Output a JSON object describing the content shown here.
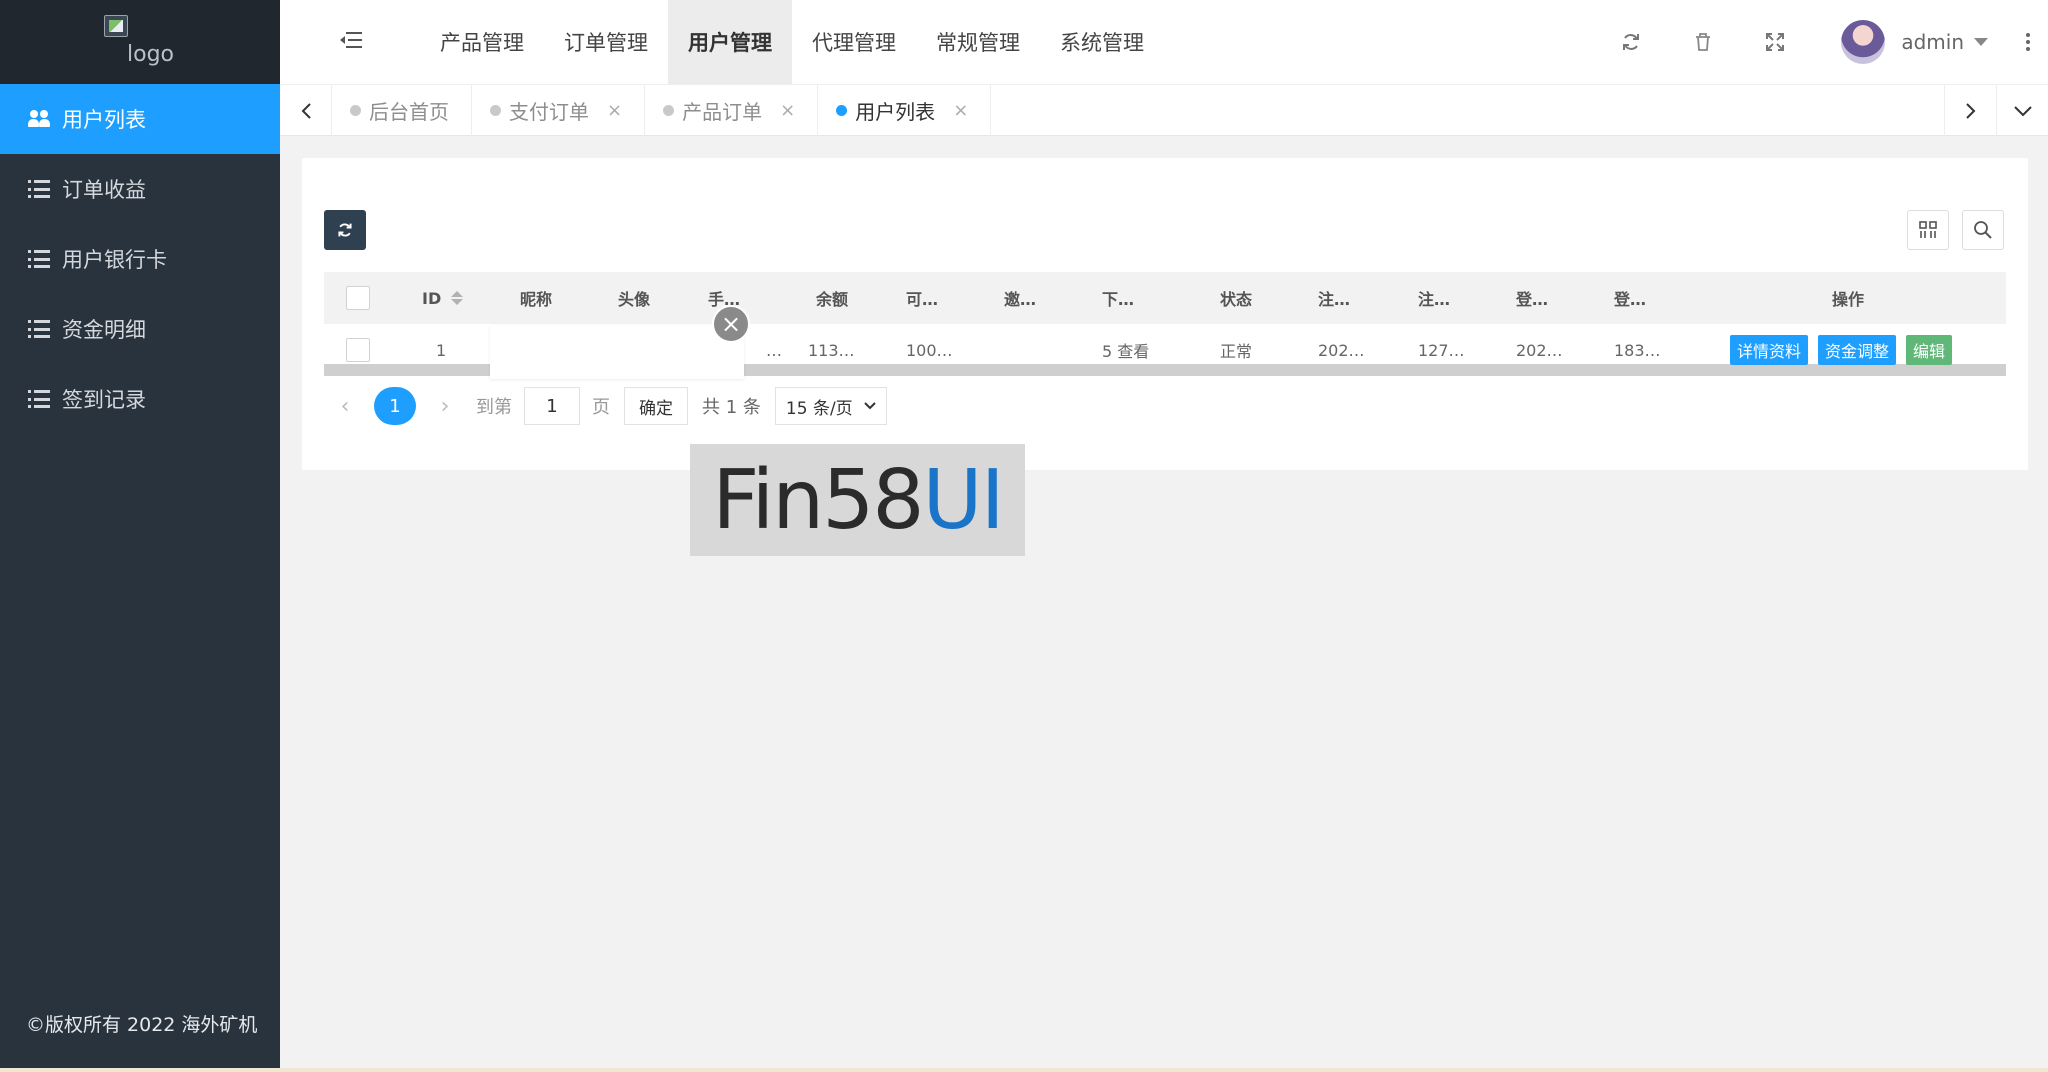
{
  "logo": {
    "alt": "logo"
  },
  "sidebar": {
    "items": [
      {
        "label": "用户列表",
        "icon": "users-icon",
        "active": true
      },
      {
        "label": "订单收益",
        "icon": "list-icon"
      },
      {
        "label": "用户银行卡",
        "icon": "list-icon"
      },
      {
        "label": "资金明细",
        "icon": "list-icon"
      },
      {
        "label": "签到记录",
        "icon": "list-icon"
      }
    ],
    "footer": "©版权所有 2022 海外矿机"
  },
  "header": {
    "nav": [
      "产品管理",
      "订单管理",
      "用户管理",
      "代理管理",
      "常规管理",
      "系统管理"
    ],
    "active_nav": "用户管理",
    "username": "admin"
  },
  "tabs": [
    {
      "label": "后台首页",
      "closable": false
    },
    {
      "label": "支付订单",
      "closable": true
    },
    {
      "label": "产品订单",
      "closable": true
    },
    {
      "label": "用户列表",
      "closable": true,
      "active": true
    }
  ],
  "table": {
    "columns": [
      "ID",
      "昵称",
      "头像",
      "手…",
      "余额",
      "可…",
      "邀…",
      "下…",
      "状态",
      "注…",
      "注…",
      "登…",
      "登…",
      "操作"
    ],
    "rows": [
      {
        "id": "1",
        "nickname": "",
        "avatar": "",
        "phone": "…",
        "balance": "113…",
        "available": "100…",
        "invite": "",
        "sub": "5 查看",
        "status": "正常",
        "reg_time": "202…",
        "reg_ip": "127…",
        "login_time": "202…",
        "login_ip": "183…"
      }
    ],
    "actions": [
      "详情资料",
      "资金调整",
      "编辑"
    ]
  },
  "pagination": {
    "current": "1",
    "goto_label": "到第",
    "goto_value": "1",
    "page_label": "页",
    "confirm": "确定",
    "total": "共 1 条",
    "page_size": "15 条/页"
  },
  "watermark": {
    "part1": "Fin58",
    "part2": "UI"
  },
  "colors": {
    "primary": "#1e9fff",
    "sidebar": "#28333e",
    "success": "#5fb878"
  }
}
